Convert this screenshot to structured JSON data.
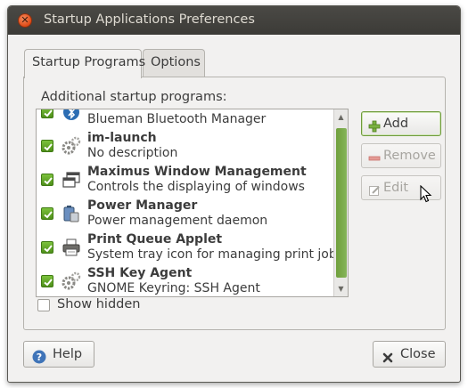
{
  "window": {
    "title": "Startup Applications Preferences"
  },
  "tabs": [
    {
      "label": "Startup Programs",
      "active": true
    },
    {
      "label": "Options",
      "active": false
    }
  ],
  "section_label": "Additional startup programs:",
  "programs": [
    {
      "name": "",
      "description": "Blueman Bluetooth Manager",
      "enabled": true,
      "icon": "bluetooth-icon"
    },
    {
      "name": "im-launch",
      "description": "No description",
      "enabled": true,
      "icon": "gears-icon"
    },
    {
      "name": "Maximus Window Management",
      "description": "Controls the displaying of windows",
      "enabled": true,
      "icon": "windows-icon"
    },
    {
      "name": "Power Manager",
      "description": "Power management daemon",
      "enabled": true,
      "icon": "battery-icon"
    },
    {
      "name": "Print Queue Applet",
      "description": "System tray icon for managing print jobs",
      "enabled": true,
      "icon": "printer-icon"
    },
    {
      "name": "SSH Key Agent",
      "description": "GNOME Keyring: SSH Agent",
      "enabled": true,
      "icon": "gears-icon"
    }
  ],
  "buttons": {
    "add": "Add",
    "remove": "Remove",
    "edit": "Edit",
    "help": "Help",
    "close": "Close"
  },
  "show_hidden": {
    "label": "Show hidden",
    "checked": false
  },
  "colors": {
    "accent": "#7cb342",
    "titlebar": "#3c3b37",
    "close": "#df4a16"
  }
}
